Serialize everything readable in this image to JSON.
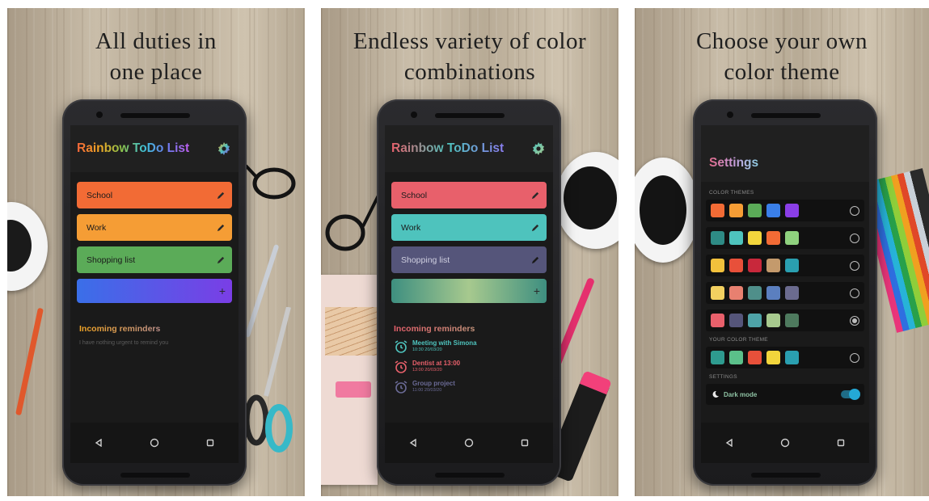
{
  "panel1": {
    "caption": [
      "All duties in",
      "one place"
    ],
    "app_title": "Rainbow ToDo List",
    "lists": [
      {
        "label": "School",
        "color": "#f26b35"
      },
      {
        "label": "Work",
        "color": "#f59d35"
      },
      {
        "label": "Shopping list",
        "color": "#5bab58"
      }
    ],
    "add_label": "+",
    "add_gradient": [
      "#3a6fe8",
      "#7a3ee6"
    ],
    "reminders_title": "Incoming reminders",
    "reminders_empty": "I have nothing urgent to remind you"
  },
  "panel2": {
    "caption": [
      "Endless variety of color",
      "combinations"
    ],
    "app_title": "Rainbow ToDo List",
    "lists": [
      {
        "label": "School",
        "color": "#e8606b"
      },
      {
        "label": "Work",
        "color": "#4ec3bd"
      },
      {
        "label": "Shopping list",
        "color": "#55557a"
      }
    ],
    "add_label": "+",
    "add_gradient": [
      "#3e8f80",
      "#a7c98e",
      "#3e8f80"
    ],
    "reminders_title": "Incoming reminders",
    "reminders": [
      {
        "title": "Meeting with Simona",
        "date": "10:30 20/03/20",
        "color": "#4ec3bd"
      },
      {
        "title": "Dentist at 13:00",
        "date": "13:00 20/03/20",
        "color": "#e8606b"
      },
      {
        "title": "Group project",
        "date": "11:00 20/03/20",
        "color": "#55557a"
      }
    ]
  },
  "panel3": {
    "caption": [
      "Choose your own",
      "color theme"
    ],
    "title": "Settings",
    "color_themes_label": "COLOR THEMES",
    "themes": [
      {
        "colors": [
          "#f26b35",
          "#f59d35",
          "#5bab58",
          "#3a7fe8",
          "#8a3ee6"
        ],
        "selected": false
      },
      {
        "colors": [
          "#2e8b85",
          "#4ec3bd",
          "#f2d53c",
          "#f26b35",
          "#8fd17e"
        ],
        "selected": false
      },
      {
        "colors": [
          "#f2c13c",
          "#e8503a",
          "#c8283b",
          "#c49a6c",
          "#2a9fb0"
        ],
        "selected": false
      },
      {
        "colors": [
          "#f2d060",
          "#e88070",
          "#4f8f8a",
          "#5b7fbf",
          "#6b6b8f"
        ],
        "selected": false
      },
      {
        "colors": [
          "#e8606b",
          "#55557a",
          "#4ea3a8",
          "#a7c98e",
          "#4e7a5e"
        ],
        "selected": true
      }
    ],
    "your_theme_label": "YOUR COLOR THEME",
    "your_theme": {
      "colors": [
        "#2e9b8f",
        "#5bc08a",
        "#e8503a",
        "#f2d53c",
        "#2a9fb0"
      ],
      "selected": false
    },
    "settings_label": "SETTINGS",
    "dark_mode_label": "Dark mode",
    "dark_mode_on": true
  }
}
